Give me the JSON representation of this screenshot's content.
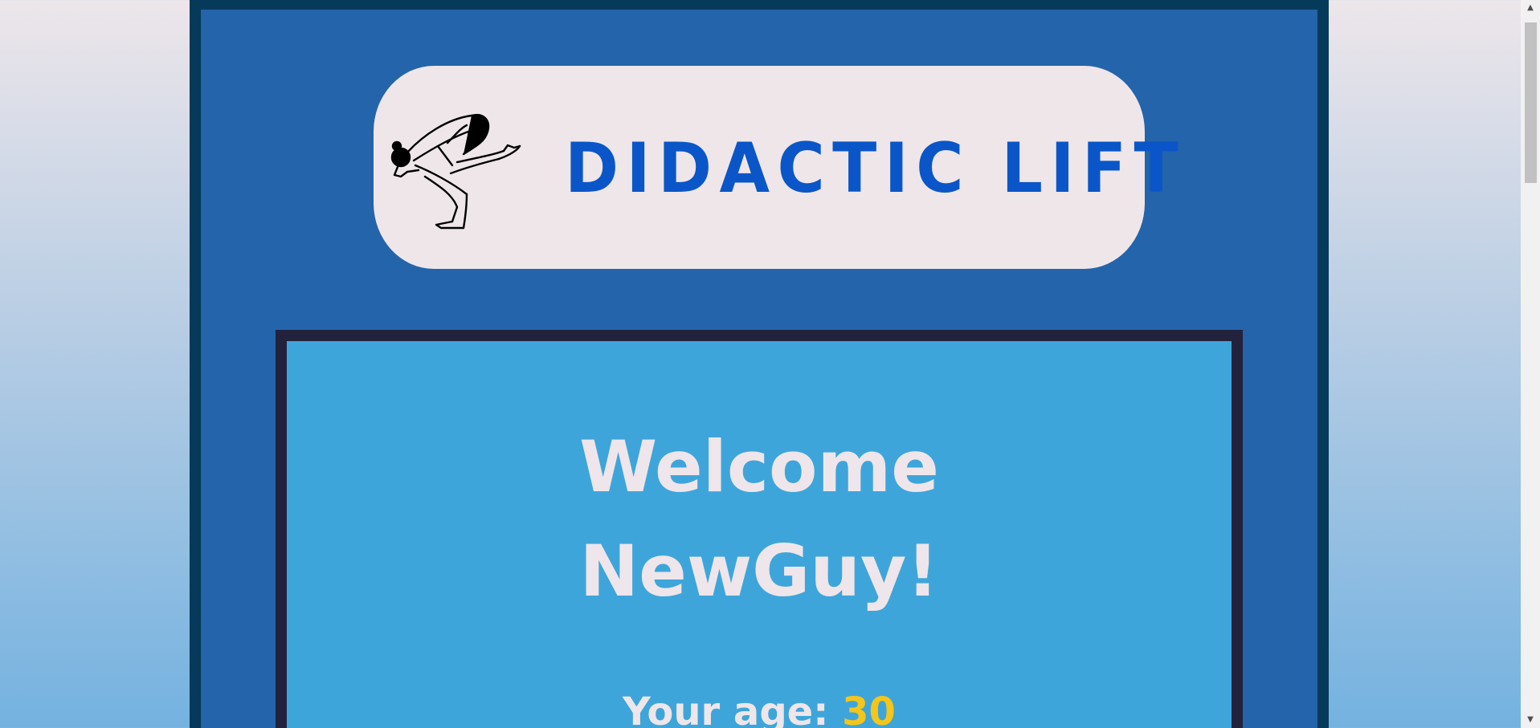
{
  "brand": {
    "name": "DIDACTIC LIFT",
    "logo_icon": "yoga-crow-pose-figure-icon",
    "text_color": "#0a56c8"
  },
  "welcome": {
    "line1": "Welcome",
    "line2": "NewGuy!"
  },
  "profile": {
    "age_label": "Your age:",
    "age_value": "30",
    "age_value_color": "#f5c518"
  },
  "scrollbar": {
    "up_icon": "▲",
    "down_icon": "▼"
  }
}
